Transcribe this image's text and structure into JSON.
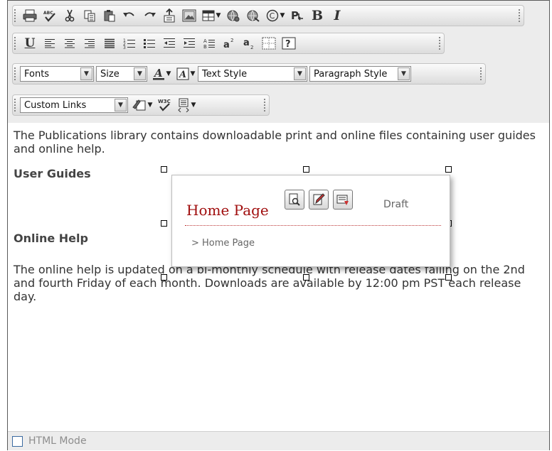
{
  "toolbar": {
    "row1_icons": [
      "print-icon",
      "spellcheck-icon",
      "cut-icon",
      "copy-icon",
      "paste-icon",
      "undo-icon",
      "redo-icon",
      "insert-file-icon",
      "insert-image-icon",
      "insert-table-icon",
      "insert-link-icon",
      "remove-link-icon",
      "special-character-icon",
      "paragraph-mark-icon",
      "bold-icon",
      "italic-icon"
    ],
    "row2_icons": [
      "underline-icon",
      "align-left-icon",
      "align-center-icon",
      "align-right-icon",
      "justify-icon",
      "numbered-list-icon",
      "bulleted-list-icon",
      "outdent-icon",
      "indent-icon",
      "line-spacing-icon",
      "superscript-icon",
      "subscript-icon",
      "show-borders-icon",
      "help-icon"
    ],
    "fonts_label": "Fonts",
    "size_label": "Size",
    "text_style_label": "Text Style",
    "paragraph_style_label": "Paragraph Style",
    "custom_links_label": "Custom Links",
    "validate_label": "W3C"
  },
  "content": {
    "intro": "The Publications library contains downloadable print and online files containing user guides and online help.",
    "heading_user_guides": "User Guides",
    "heading_online_help": "Online Help",
    "body": "The online help is updated on a bi-monthly schedule with release dates falling on the 2nd and fourth Friday of each month. Downloads are available by 12:00 pm PST each release day."
  },
  "popup": {
    "title": "Home Page",
    "status": "Draft",
    "breadcrumb": "> Home Page",
    "buttons": [
      "preview-icon",
      "edit-icon",
      "workflow-icon"
    ]
  },
  "footer": {
    "html_mode_label": "HTML Mode"
  },
  "colors": {
    "toolbar_bg": "#ececec",
    "popup_title": "#a00e0e",
    "text": "#333333"
  }
}
